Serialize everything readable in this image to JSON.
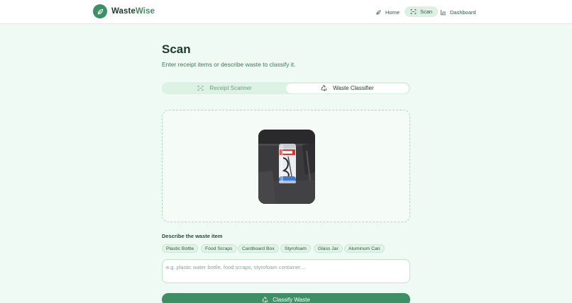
{
  "header": {
    "brand_part1": "Waste",
    "brand_part2": "Wise",
    "nav": [
      {
        "label": "Home",
        "icon": "leaf-icon",
        "active": false
      },
      {
        "label": "Scan",
        "icon": "scan-icon",
        "active": true
      },
      {
        "label": "Dashboard",
        "icon": "bar-chart-icon",
        "active": false
      }
    ]
  },
  "page": {
    "title": "Scan",
    "subtitle": "Enter receipt items or describe waste to classify it."
  },
  "tabs": [
    {
      "label": "Receipt Scanner",
      "icon": "scan-icon",
      "active": false
    },
    {
      "label": "Waste Classifier",
      "icon": "recycle-icon",
      "active": true
    }
  ],
  "upload": {
    "image_subject": "aluminum drink can on dark surface"
  },
  "describe": {
    "label": "Describe the waste item",
    "chips": [
      "Plastic Bottle",
      "Food Scraps",
      "Cardboard Box",
      "Styrofoam",
      "Glass Jar",
      "Aluminum Can"
    ],
    "placeholder": "e.g. plastic water bottle, food scraps, styrofoam container...",
    "value": ""
  },
  "actions": {
    "classify_label": "Classify Waste"
  },
  "colors": {
    "accent": "#3f8f66",
    "background": "#eefaf3",
    "text_dark": "#1f3a2c"
  }
}
